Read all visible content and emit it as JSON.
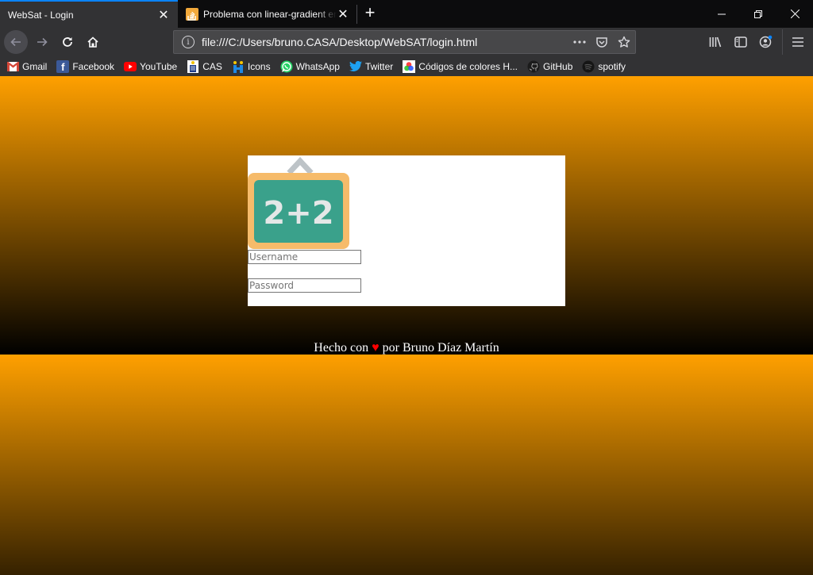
{
  "browser": {
    "tabs": [
      {
        "title": "WebSat - Login",
        "active": true
      },
      {
        "title": "Problema con linear-gradient en",
        "active": false,
        "favicon": "stackoverflow-icon"
      }
    ],
    "new_tab_label": "+",
    "url": "file:///C:/Users/bruno.CASA/Desktop/WebSAT/login.html",
    "url_actions": [
      "page-actions-icon",
      "pocket-icon",
      "bookmark-star-icon"
    ],
    "toolbar_icons": [
      "library-icon",
      "sidebar-icon",
      "account-icon",
      "hamburger-menu-icon"
    ],
    "accent_color": "#0a84ff",
    "bookmarks": [
      {
        "label": "Gmail",
        "icon": "gmail-icon"
      },
      {
        "label": "Facebook",
        "icon": "facebook-icon"
      },
      {
        "label": "YouTube",
        "icon": "youtube-icon"
      },
      {
        "label": "CAS",
        "icon": "cas-icon"
      },
      {
        "label": "Icons",
        "icon": "icons-icon"
      },
      {
        "label": "WhatsApp",
        "icon": "whatsapp-icon"
      },
      {
        "label": "Twitter",
        "icon": "twitter-icon"
      },
      {
        "label": "Códigos de colores H...",
        "icon": "color-wheel-icon"
      },
      {
        "label": "GitHub",
        "icon": "github-icon"
      },
      {
        "label": "spotify",
        "icon": "spotify-icon"
      }
    ]
  },
  "page": {
    "background_gradient": {
      "from": "#ffa000",
      "to": "#000000",
      "repeating": true
    },
    "logo": {
      "text": "2+2",
      "board_color": "#3aa18b",
      "frame_color": "#f6bb6a",
      "hanger_color": "#bdc3c7",
      "text_color": "#e4e7e7"
    },
    "login": {
      "username_placeholder": "Username",
      "username_value": "",
      "password_placeholder": "Password",
      "password_value": ""
    },
    "footer": {
      "prefix": "Hecho con",
      "heart": "♥",
      "suffix": "por Bruno Díaz Martín"
    }
  }
}
